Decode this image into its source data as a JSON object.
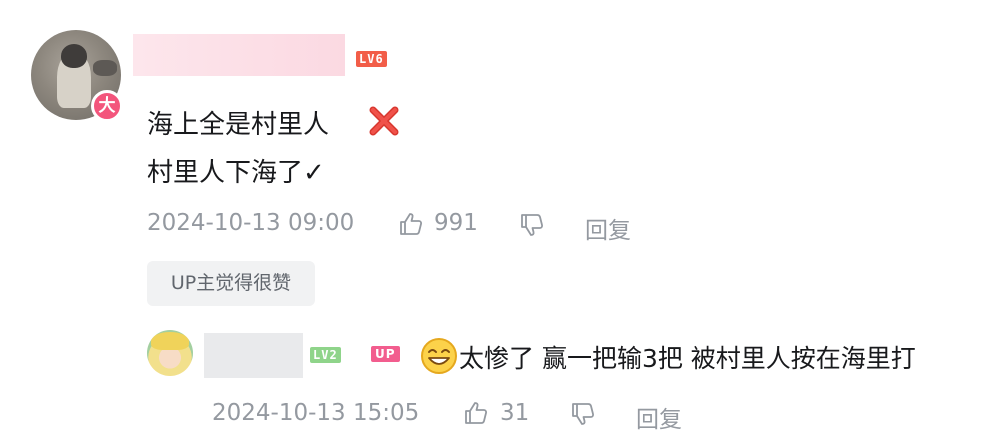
{
  "comment": {
    "avatar_badge": "大",
    "level": "LV6",
    "content_line1": "海上全是村里人",
    "content_line2": "村里人下海了✓",
    "time": "2024-10-13 09:00",
    "likes": "991",
    "reply_label": "回复",
    "up_liked_label": "UP主觉得很赞"
  },
  "reply": {
    "level": "LV2",
    "up_badge": "UP",
    "content": "太惨了 赢一把输3把 被村里人按在海里打",
    "time": "2024-10-13 15:05",
    "likes": "31",
    "reply_label": "回复"
  },
  "colors": {
    "accent_pink": "#f3557c",
    "level6_color": "#f25d48",
    "level2_color": "#8fd48a",
    "meta_gray": "#9499a0",
    "text_dark": "#18191c"
  },
  "icons": [
    "cross-icon",
    "like-icon",
    "dislike-icon",
    "grin-emoji-icon"
  ]
}
